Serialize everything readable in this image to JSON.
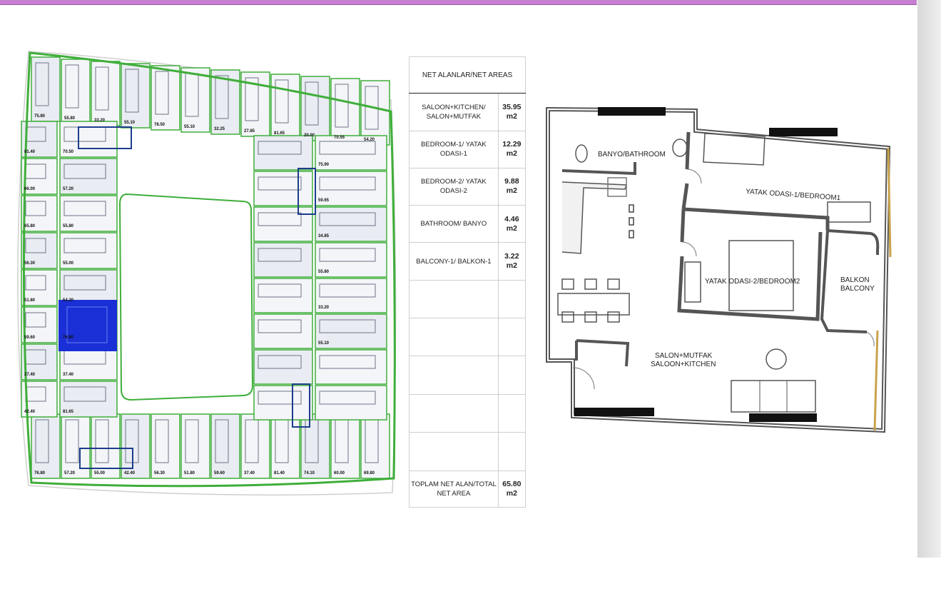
{
  "table": {
    "header": "NET ALANLAR/NET AREAS",
    "rows": [
      {
        "label": "SALOON+KITCHEN/ SALON+MUTFAK",
        "value": "35.95 m2"
      },
      {
        "label": "BEDROOM-1/ YATAK ODASI-1",
        "value": "12.29 m2"
      },
      {
        "label": "BEDROOM-2/ YATAK ODASI-2",
        "value": "9.88 m2"
      },
      {
        "label": "BATHROOM/ BANYO",
        "value": "4.46 m2"
      },
      {
        "label": "BALCONY-1/ BALKON-1",
        "value": "3.22 m2"
      }
    ],
    "total_label": "TOPLAM NET ALAN/TOTAL NET AREA",
    "total_value": "65.80 m2"
  },
  "unit_plan": {
    "bathroom": "BANYO/BATHROOM",
    "bedroom1": "YATAK ODASI-1/BEDROOM1",
    "bedroom2": "YATAK ODASI-2/BEDROOM2",
    "balcony_tr": "BALKON",
    "balcony_en": "BALCONY",
    "salon_tr": "SALON+MUTFAK",
    "salon_en": "SALOON+KITCHEN"
  },
  "floor_plan": {
    "highlight_color": "#1a2fd6",
    "wall_color": "#3fae3a",
    "area_labels": [
      "75.80",
      "55.80",
      "33.20",
      "55.10",
      "78.50",
      "55.10",
      "32.25",
      "27.85",
      "81.65",
      "20.00",
      "70.55",
      "54.20",
      "76.80",
      "57.20",
      "55.00",
      "42.40",
      "56.30",
      "51.80",
      "59.60",
      "37.40",
      "81.40",
      "74.10",
      "60.00",
      "69.80",
      "81.40",
      "66.00",
      "65.80",
      "56.30",
      "51.80",
      "59.60",
      "27.40",
      "42.40",
      "70.50",
      "57.20",
      "55.80",
      "55.00",
      "54.20",
      "76.80",
      "37.40",
      "81.65",
      "75.90",
      "59.65",
      "34.85",
      "55.80",
      "33.20",
      "55.10"
    ]
  },
  "colors": {
    "top_bar": "#c77fd1",
    "border": "#222222"
  }
}
